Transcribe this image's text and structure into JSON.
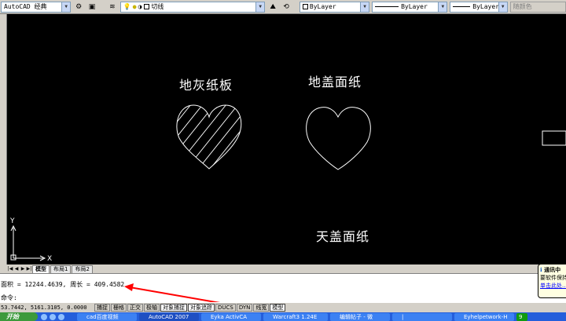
{
  "toolbar": {
    "workspace": "AutoCAD 经典",
    "layer": "切线",
    "color": "ByLayer",
    "linetype": "ByLayer",
    "lineweight": "ByLayer",
    "plotstyle": "随颜色"
  },
  "drawing": {
    "label_left_heart": "地灰纸板",
    "label_right_heart": "地盖面纸",
    "label_bottom": "天盖面纸",
    "ucs_x": "X",
    "ucs_y": "Y"
  },
  "tabs": {
    "model": "模型",
    "layout1": "布局1",
    "layout2": "布局2"
  },
  "command": {
    "result_line": "面积 = 12244.4639, 周长 = 409.4582",
    "prompt": "命令:"
  },
  "status": {
    "coords": "53.7442, 5161.3105, 0.0000",
    "snap": "捕捉",
    "grid": "栅格",
    "ortho": "正交",
    "polar": "极轴",
    "osnap": "对象捕捉",
    "otrack": "对象追踪",
    "ducs": "DUCS",
    "dyn": "DYN",
    "lwt": "线宽",
    "model": "模型"
  },
  "taskbar": {
    "start": "开始",
    "items": [
      "cad百度视频",
      "AutoCAD 2007",
      "Eyka ActivCA",
      "Warcraft3 1.24E",
      "编辑帖子 - 微",
      "|",
      "Eyhelpetwork-H",
      "9"
    ]
  },
  "notification": {
    "title": "通讯中",
    "body": "要软件保持",
    "link": "单击此处..."
  },
  "colors": {
    "canvas": "#000000",
    "drawing_stroke": "#ffffff",
    "annotation_arrow": "#ff0000"
  }
}
